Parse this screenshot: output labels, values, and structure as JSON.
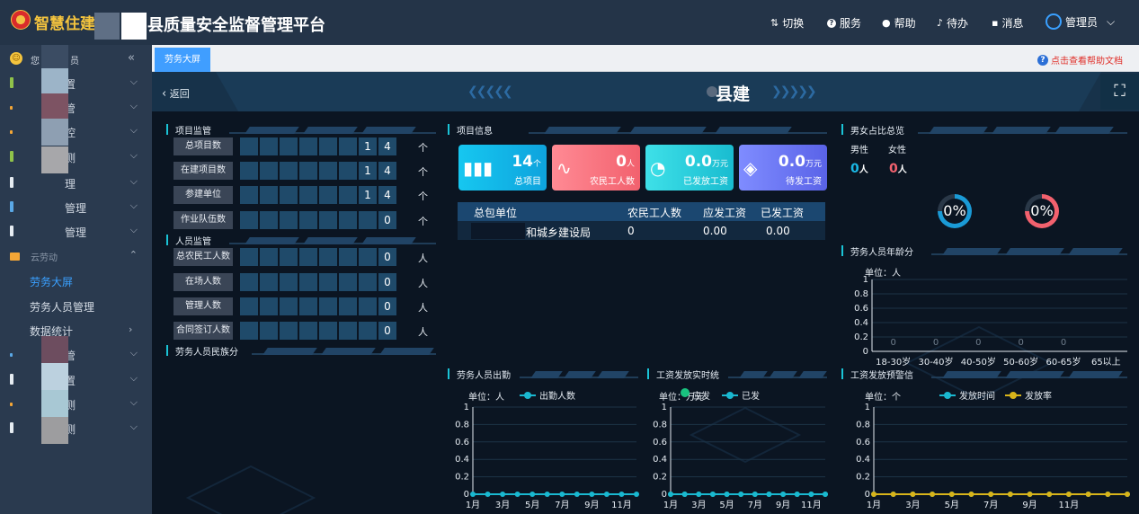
{
  "header": {
    "logo_text": "智慧住建",
    "title": "县质量安全监督管理平台",
    "menu": [
      {
        "icon": "⇅",
        "label": "切换"
      },
      {
        "icon": "?",
        "label": "服务"
      },
      {
        "icon": "●",
        "label": "帮助"
      },
      {
        "icon": "♪",
        "label": "待办"
      },
      {
        "icon": "▪",
        "label": "消息"
      }
    ],
    "user": "管理员"
  },
  "sidebar": {
    "greeting_a": "您",
    "greeting_b": "员",
    "collapse_glyph": "«",
    "items": [
      "置",
      "管",
      "控",
      "测",
      "理",
      "管理",
      "管理"
    ],
    "group": "云劳动",
    "sub": [
      "劳务大屏",
      "劳务人员管理",
      "数据统计"
    ],
    "items2": [
      "管",
      "置",
      "测",
      "测"
    ]
  },
  "tabs": {
    "active": "劳务大屏",
    "help": "点击查看帮助文档"
  },
  "dash": {
    "back": "返回",
    "title": "县建",
    "chev_left": "❮❮❮❮❮",
    "chev_right": "❯❯❯❯❯"
  },
  "project_supervision": {
    "title": "项目监管",
    "rows": [
      {
        "label": "总项目数",
        "digits": [
          "",
          "",
          "",
          "",
          "",
          "",
          "1",
          "4"
        ],
        "unit": "个"
      },
      {
        "label": "在建项目数",
        "digits": [
          "",
          "",
          "",
          "",
          "",
          "",
          "1",
          "4"
        ],
        "unit": "个"
      },
      {
        "label": "参建单位",
        "digits": [
          "",
          "",
          "",
          "",
          "",
          "",
          "1",
          "4"
        ],
        "unit": "个"
      },
      {
        "label": "作业队伍数",
        "digits": [
          "",
          "",
          "",
          "",
          "",
          "",
          "",
          "0"
        ],
        "unit": "个"
      }
    ]
  },
  "personnel_supervision": {
    "title": "人员监管",
    "rows": [
      {
        "label": "总农民工人数",
        "digits": [
          "",
          "",
          "",
          "",
          "",
          "",
          "",
          "0"
        ],
        "unit": "人"
      },
      {
        "label": "在场人数",
        "digits": [
          "",
          "",
          "",
          "",
          "",
          "",
          "",
          "0"
        ],
        "unit": "人"
      },
      {
        "label": "管理人数",
        "digits": [
          "",
          "",
          "",
          "",
          "",
          "",
          "",
          "0"
        ],
        "unit": "人"
      },
      {
        "label": "合同签订人数",
        "digits": [
          "",
          "",
          "",
          "",
          "",
          "",
          "",
          "0"
        ],
        "unit": "人"
      }
    ]
  },
  "ethnic": {
    "title": "劳务人员民族分"
  },
  "project_info": {
    "title": "项目信息",
    "cards": [
      {
        "value": "14",
        "unit": "个",
        "label": "总项目",
        "color_a": "#16c7f0",
        "color_b": "#0ea3dd"
      },
      {
        "value": "0",
        "unit": "人",
        "label": "农民工人数",
        "color_a": "#ff8a94",
        "color_b": "#f2616e"
      },
      {
        "value": "0.0",
        "unit": "万元",
        "label": "已发放工资",
        "color_a": "#3ee0e8",
        "color_b": "#19bcd0"
      },
      {
        "value": "0.0",
        "unit": "万元",
        "label": "待发工资",
        "color_a": "#7f8cff",
        "color_b": "#5a63e8"
      }
    ],
    "table": {
      "headers": [
        "总包单位",
        "农民工人数",
        "应发工资",
        "已发工资"
      ],
      "rows": [
        [
          "和城乡建设局",
          "0",
          "0.00",
          "0.00"
        ]
      ]
    }
  },
  "gender": {
    "title": "男女占比总览",
    "male_label": "男性",
    "female_label": "女性",
    "male": "0",
    "female": "0",
    "unit": "人",
    "male_pct": "0%",
    "female_pct": "0%",
    "male_color": "#1a9ad6",
    "female_color": "#f2616e"
  },
  "age": {
    "title": "劳务人员年龄分",
    "unit_label": "单位：人"
  },
  "attendance": {
    "title": "劳务人员出勤",
    "unit_label": "单位：人",
    "legend": "出勤人数"
  },
  "wage": {
    "title": "工资发放实时统",
    "unit_label": "单位：万元",
    "legend_a": "应发",
    "legend_b": "已发"
  },
  "warning": {
    "title": "工资发放预警信",
    "unit_label": "单位：个",
    "legend_a": "发放时间",
    "legend_b": "发放率"
  },
  "chart_data": [
    {
      "type": "bar",
      "title": "劳务人员年龄分",
      "categories": [
        "18-30岁",
        "30-40岁",
        "40-50岁",
        "50-60岁",
        "60-65岁",
        "65以上"
      ],
      "values": [
        0,
        0,
        0,
        0,
        0,
        null
      ],
      "ylim": [
        0,
        1
      ],
      "yticks": [
        "0",
        "0.2",
        "0.4",
        "0.6",
        "0.8",
        "1"
      ],
      "value_labels": [
        "0",
        "0",
        "0",
        "0",
        "0",
        ""
      ]
    },
    {
      "type": "line",
      "title": "劳务人员出勤",
      "x": [
        "1月",
        "3月",
        "5月",
        "7月",
        "9月",
        "11月"
      ],
      "series": [
        {
          "name": "出勤人数",
          "values": [
            0,
            0,
            0,
            0,
            0,
            0,
            0,
            0,
            0,
            0,
            0,
            0
          ],
          "color": "#1ab8d0"
        }
      ],
      "ylim": [
        0,
        1
      ],
      "yticks": [
        "0",
        "0.2",
        "0.4",
        "0.6",
        "0.8",
        "1"
      ]
    },
    {
      "type": "line",
      "title": "工资发放实时统",
      "x": [
        "1月",
        "3月",
        "5月",
        "7月",
        "9月",
        "11月"
      ],
      "series": [
        {
          "name": "应发",
          "values": [
            0,
            0,
            0,
            0,
            0,
            0,
            0,
            0,
            0,
            0,
            0,
            0
          ],
          "color": "#19c27f"
        },
        {
          "name": "已发",
          "values": [
            0,
            0,
            0,
            0,
            0,
            0,
            0,
            0,
            0,
            0,
            0,
            0
          ],
          "color": "#1ab8d0"
        }
      ],
      "ylim": [
        0,
        1
      ],
      "yticks": [
        "0",
        "0.2",
        "0.4",
        "0.6",
        "0.8",
        "1"
      ]
    },
    {
      "type": "line",
      "title": "工资发放预警信",
      "x": [
        "1月",
        "3月",
        "5月",
        "7月",
        "9月",
        "11月"
      ],
      "series": [
        {
          "name": "发放时间",
          "values": [
            0,
            0,
            0,
            0,
            0,
            0,
            0,
            0,
            0,
            0,
            0,
            0,
            0,
            0
          ],
          "color": "#1ab8d0"
        },
        {
          "name": "发放率",
          "values": [
            0,
            0,
            0,
            0,
            0,
            0,
            0,
            0,
            0,
            0,
            0,
            0,
            0,
            0
          ],
          "color": "#d8b41a"
        }
      ],
      "ylim": [
        0,
        1
      ],
      "yticks": [
        "0",
        "0.2",
        "0.4",
        "0.6",
        "0.8",
        "1"
      ]
    }
  ]
}
